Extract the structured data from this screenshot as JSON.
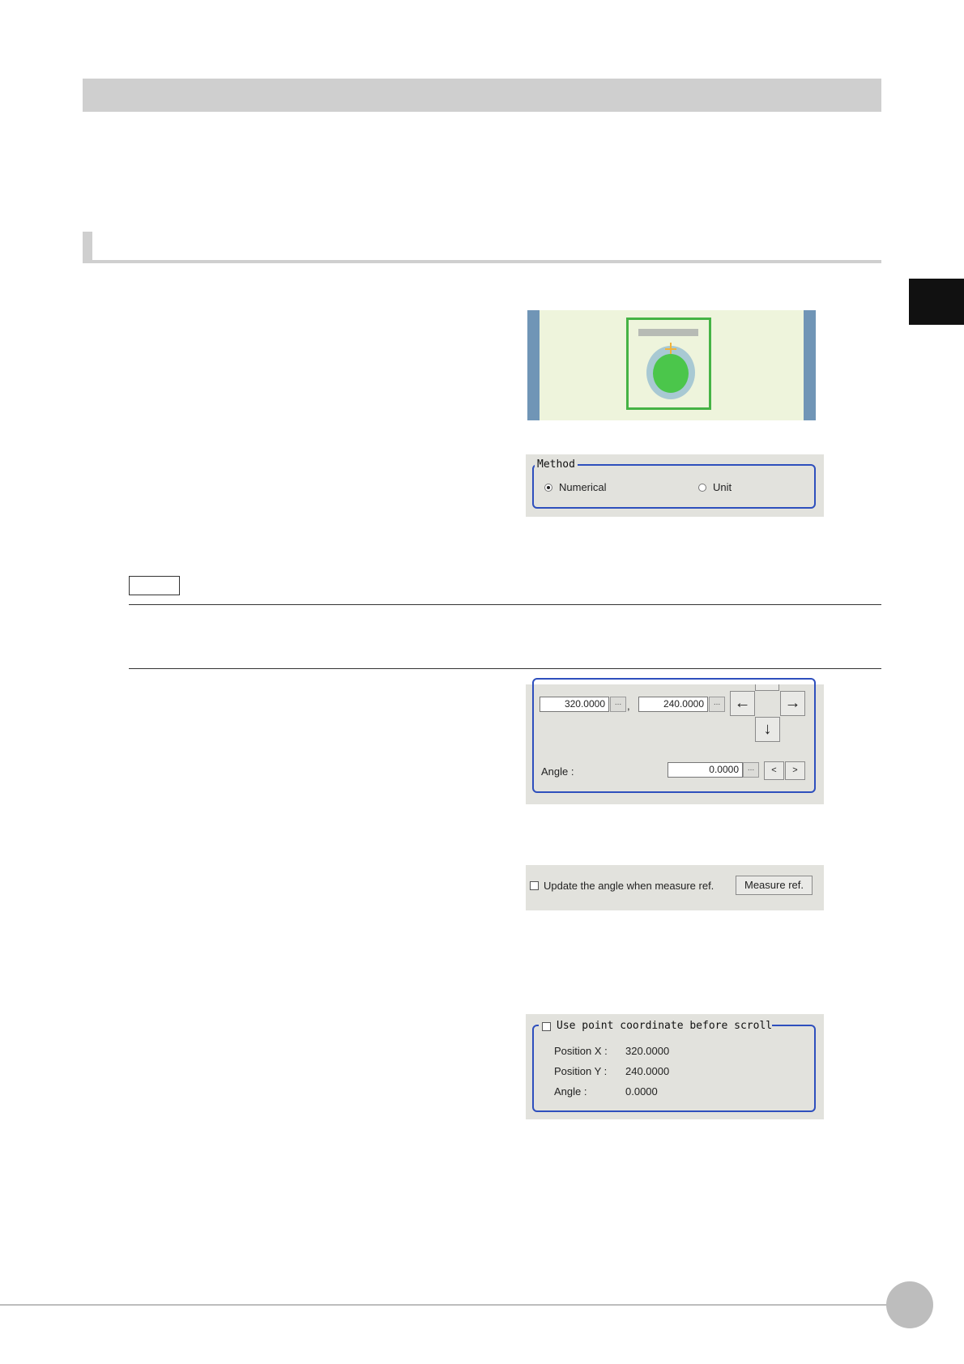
{
  "method_panel": {
    "legend": "Method",
    "options": [
      "Numerical",
      "Unit"
    ],
    "selected": "Numerical"
  },
  "position_panel": {
    "x_value": "320.0000",
    "y_value": "240.0000",
    "separator": ",",
    "ellipsis": "...",
    "arrow_left": "←",
    "arrow_right": "→",
    "arrow_down": "↓",
    "angle_label": "Angle :",
    "angle_value": "0.0000",
    "angle_dec": "<",
    "angle_inc": ">"
  },
  "measure_panel": {
    "checkbox_label": "Update the angle when measure ref.",
    "button_label": "Measure ref."
  },
  "scroll_panel": {
    "legend": "Use point coordinate before scroll",
    "rows": [
      {
        "label": "Position X :",
        "value": "320.0000"
      },
      {
        "label": "Position Y :",
        "value": "240.0000"
      },
      {
        "label": "Angle :",
        "value": "0.0000"
      }
    ]
  },
  "colors": {
    "group_border": "#2e4fbd",
    "panel_bg": "#e2e2dd",
    "preview_bg": "#eef4dc",
    "accent_green": "#4bc64b"
  }
}
